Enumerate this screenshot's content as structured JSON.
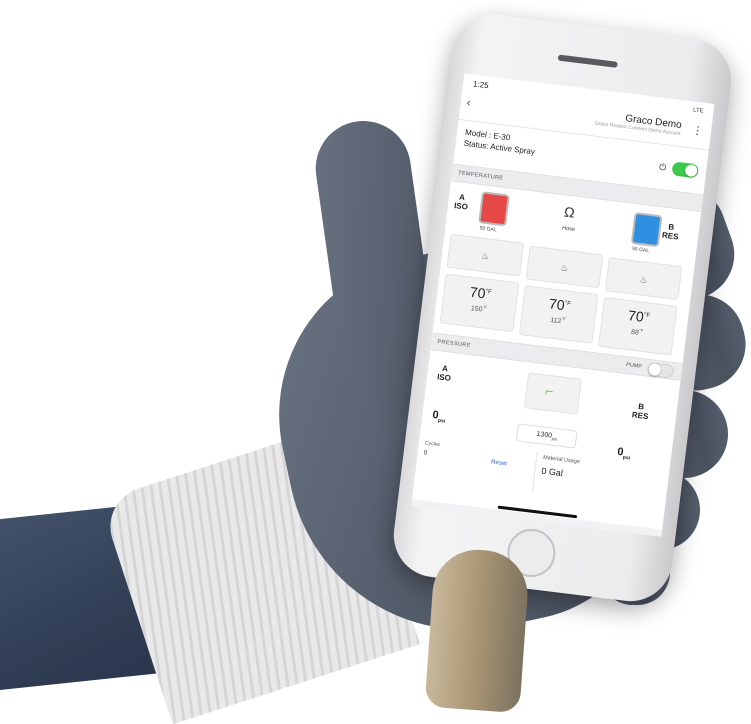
{
  "status_bar": {
    "time": "1:25",
    "indicators": "LTE"
  },
  "header": {
    "title": "Graco Demo",
    "subtitle": "Graco Reactor Connect Demo Account",
    "back_icon": "chevron-left-icon",
    "menu_icon": "more-vertical-icon"
  },
  "device": {
    "model": "Model : E-30",
    "status": "Status: Active Spray",
    "power_on": true
  },
  "temperature": {
    "section_title": "TEMPERATURE",
    "iso": {
      "letter": "A",
      "name": "ISO",
      "gallons": "55",
      "gal_unit": "GAL",
      "color": "#e64747"
    },
    "hose": {
      "label": "Hose"
    },
    "res": {
      "letter": "B",
      "name": "RES",
      "gallons": "55",
      "gal_unit": "GAL",
      "color": "#2f8fe0"
    },
    "heat_icon": "heater-icon",
    "readings": [
      {
        "value": "70",
        "unit": "°F",
        "setpoint": "150",
        "set_unit": "°F"
      },
      {
        "value": "70",
        "unit": "°F",
        "setpoint": "112",
        "set_unit": "°F"
      },
      {
        "value": "70",
        "unit": "°F",
        "setpoint": "88",
        "set_unit": "°F"
      }
    ]
  },
  "pressure": {
    "section_title": "PRESSURE",
    "pump_label": "PUMP",
    "pump_on": false,
    "iso": {
      "letter": "A",
      "name": "ISO",
      "value": "0",
      "unit": "psi"
    },
    "res": {
      "letter": "B",
      "name": "RES",
      "value": "0",
      "unit": "psi"
    },
    "gun_icon": "spray-gun-icon",
    "setpoint": "1300",
    "setpoint_unit": "psi",
    "cycles_label": "Cycles",
    "cycles_value": "0",
    "reset_label": "Reset",
    "material_usage_label": "Material Usage",
    "material_usage_value": "0 Gal"
  }
}
